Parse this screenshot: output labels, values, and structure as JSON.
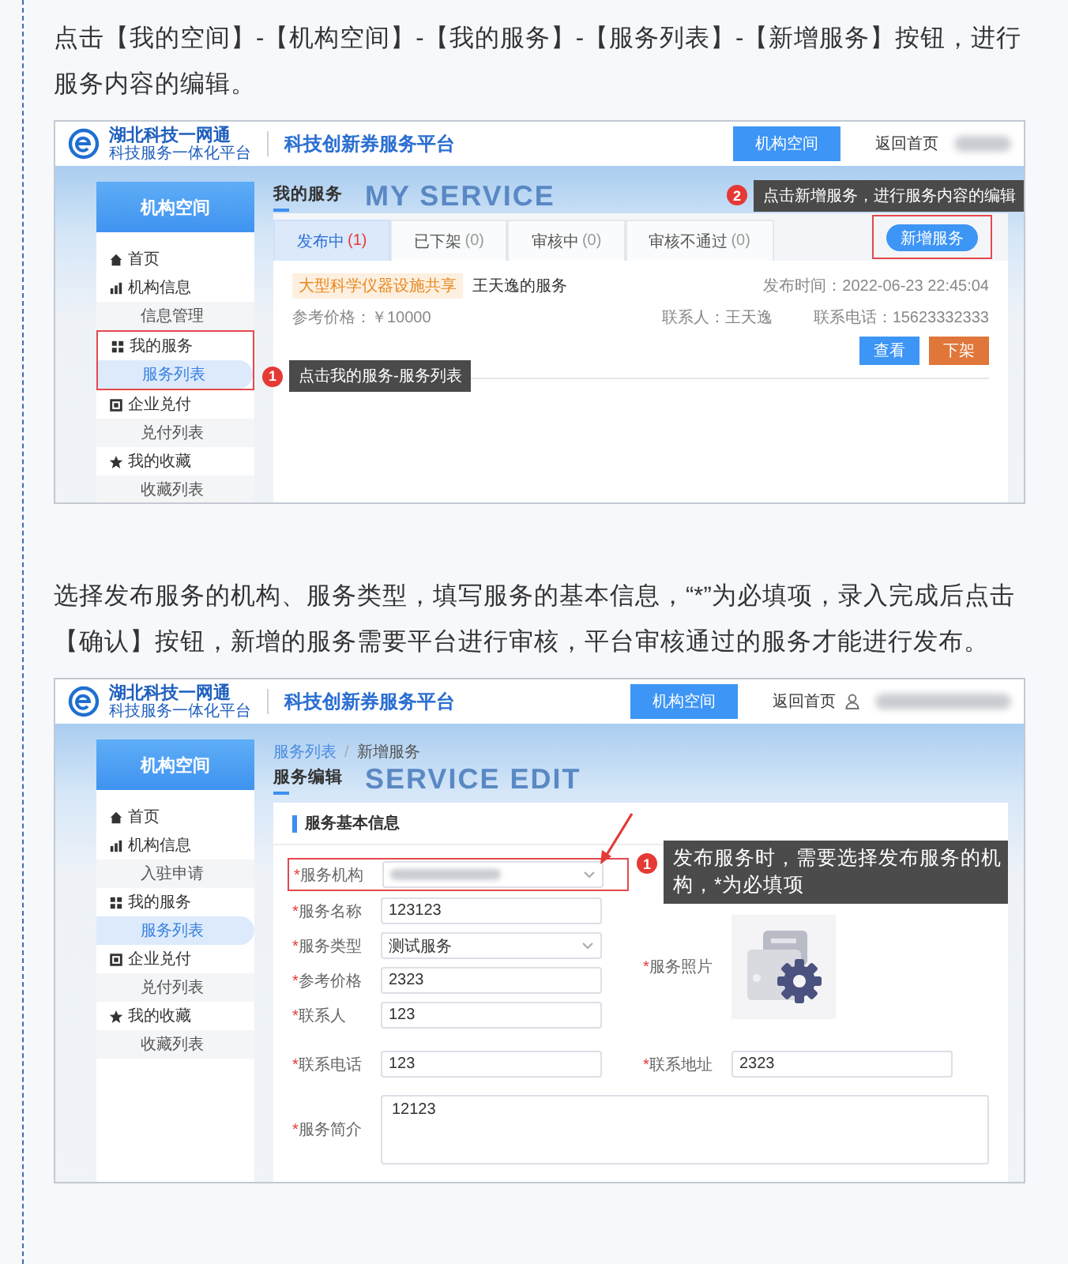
{
  "sections": [
    {
      "text": "点击【我的空间】-【机构空间】-【我的服务】-【服务列表】-【新增服务】按钮，进行服务内容的编辑。",
      "screenshot": {
        "kind": "service_list",
        "header": {
          "logo_title": "湖北科技一网通",
          "logo_subtitle": "科技服务一体化平台",
          "platform_title": "科技创新券服务平台",
          "nav_button": "机构空间",
          "home_link": "返回首页",
          "user_icon": false
        },
        "sidebar": {
          "title": "机构空间",
          "items": [
            {
              "label": "首页",
              "selected": false
            },
            {
              "label": "机构信息",
              "selected": false,
              "children": [
                {
                  "label": "信息管理",
                  "selected": false
                }
              ]
            },
            {
              "label": "我的服务",
              "selected": false,
              "highlighted": true,
              "callout": {
                "number": "1",
                "text": "点击我的服务-服务列表"
              },
              "children": [
                {
                  "label": "服务列表",
                  "selected": true
                }
              ]
            },
            {
              "label": "企业兑付",
              "selected": false,
              "children": [
                {
                  "label": "兑付列表",
                  "selected": false
                }
              ]
            },
            {
              "label": "我的收藏",
              "selected": false,
              "children": [
                {
                  "label": "收藏列表",
                  "selected": false
                }
              ]
            }
          ]
        },
        "content": {
          "bg_text": "MY SERVICE",
          "title": "我的服务",
          "tabs": [
            {
              "label": "发布中",
              "count": "(1)",
              "selected": true
            },
            {
              "label": "已下架",
              "count": "(0)",
              "selected": false
            },
            {
              "label": "审核中",
              "count": "(0)",
              "selected": false
            },
            {
              "label": "审核不通过",
              "count": "(0)",
              "selected": false
            }
          ],
          "add_button": {
            "label": "新增服务",
            "highlighted": true,
            "callout": {
              "number": "2",
              "text": "点击新增服务，进行服务内容的编辑"
            }
          },
          "services": [
            {
              "tag": "大型科学仪器设施共享",
              "name": "王天逸的服务",
              "published": "发布时间：2022-06-23 22:45:04",
              "price": "参考价格：￥10000",
              "contact": "联系人：王天逸",
              "phone": "联系电话：15623332333",
              "actions": [
                {
                  "label": "查看",
                  "kind": "primary"
                },
                {
                  "label": "下架",
                  "kind": "warning"
                }
              ]
            }
          ]
        }
      }
    },
    {
      "text": "选择发布服务的机构、服务类型，填写服务的基本信息，“*”为必填项，录入完成后点击【确认】按钮，新增的服务需要平台进行审核，平台审核通过的服务才能进行发布。",
      "screenshot": {
        "kind": "service_edit",
        "header": {
          "logo_title": "湖北科技一网通",
          "logo_subtitle": "科技服务一体化平台",
          "platform_title": "科技创新券服务平台",
          "nav_button": "机构空间",
          "home_link": "返回首页",
          "user_icon": true
        },
        "sidebar": {
          "title": "机构空间",
          "items": [
            {
              "label": "首页",
              "selected": false
            },
            {
              "label": "机构信息",
              "selected": false,
              "children": [
                {
                  "label": "入驻申请",
                  "selected": false
                }
              ]
            },
            {
              "label": "我的服务",
              "selected": false,
              "children": [
                {
                  "label": "服务列表",
                  "selected": true
                }
              ]
            },
            {
              "label": "企业兑付",
              "selected": false,
              "children": [
                {
                  "label": "兑付列表",
                  "selected": false
                }
              ]
            },
            {
              "label": "我的收藏",
              "selected": false,
              "children": [
                {
                  "label": "收藏列表",
                  "selected": false
                }
              ]
            }
          ]
        },
        "content": {
          "breadcrumb": [
            {
              "label": "服务列表"
            },
            {
              "label": "新增服务"
            }
          ],
          "breadcrumb_separator": "/",
          "bg_text": "SERVICE EDIT",
          "title": "服务编辑",
          "section_title": "服务基本信息",
          "fields": [
            {
              "kind": "select",
              "label": "服务机构",
              "required_mark": "*",
              "blurred": true,
              "highlighted": true,
              "callout": {
                "number": "1",
                "text": "发布服务时，需要选择发布服务的机构，*为必填项"
              }
            },
            {
              "kind": "input",
              "label": "服务名称",
              "required_mark": "*",
              "value": "123123"
            },
            {
              "kind": "select",
              "label": "服务类型",
              "required_mark": "*",
              "value": "测试服务"
            },
            {
              "kind": "input",
              "label": "参考价格",
              "required_mark": "*",
              "value": "2323"
            },
            {
              "kind": "input",
              "label": "联系人",
              "required_mark": "*",
              "value": "123"
            }
          ],
          "photo": {
            "label": "服务照片",
            "required_mark": "*"
          },
          "row_fields": [
            {
              "kind": "input",
              "label": "联系电话",
              "required_mark": "*",
              "value": "123"
            },
            {
              "kind": "input",
              "label": "联系地址",
              "required_mark": "*",
              "value": "2323"
            }
          ],
          "textarea": {
            "label": "服务简介",
            "required_mark": "*",
            "value": "12123"
          }
        }
      }
    }
  ]
}
